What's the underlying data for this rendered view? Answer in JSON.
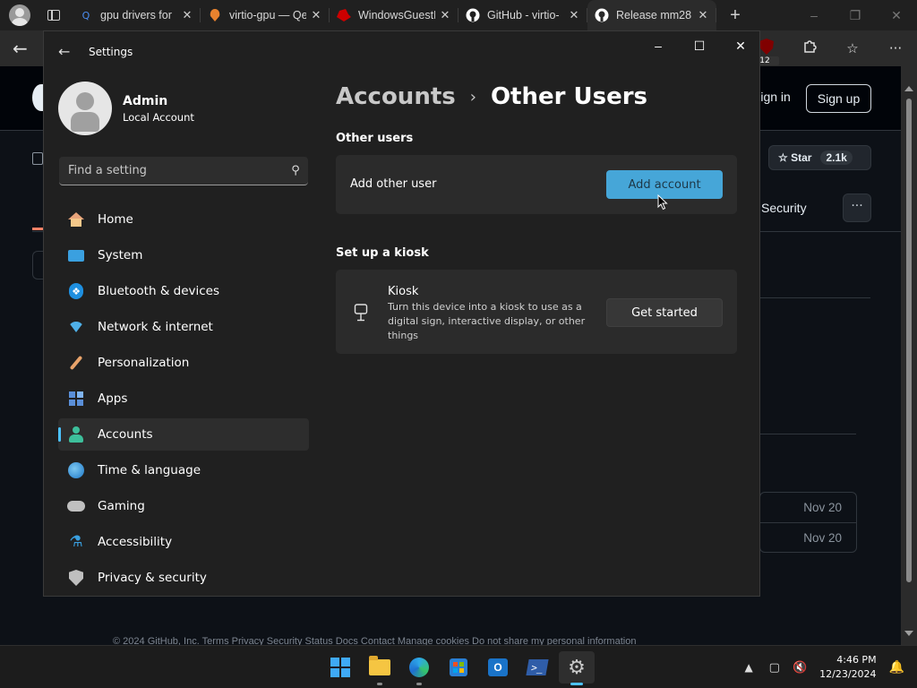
{
  "browser": {
    "tabs": [
      {
        "title": "gpu drivers for",
        "favicon": "search-icon",
        "color": "#4a8df0"
      },
      {
        "title": "virtio-gpu — Qe",
        "favicon": "qemu-logo",
        "color": "#e8822e"
      },
      {
        "title": "WindowsGuestI",
        "favicon": "redhat-logo",
        "color": "#cc0000"
      },
      {
        "title": "GitHub - virtio-",
        "favicon": "github-logo",
        "color": "#ffffff"
      },
      {
        "title": "Release mm28",
        "favicon": "github-logo",
        "color": "#ffffff",
        "active": true
      }
    ],
    "close_glyph": "✕",
    "new_tab_glyph": "+",
    "extension_badge": "12"
  },
  "github": {
    "sign_in": "Sign in",
    "sign_up": "Sign up",
    "star_label": "Star",
    "star_count": "2.1k",
    "security_tab": "Security",
    "more_glyph": "···",
    "dates": [
      "Nov 20",
      "Nov 20"
    ],
    "footer": "© 2024 GitHub, Inc.  Terms  Privacy  Security  Status  Docs  Contact  Manage cookies  Do not share my personal information"
  },
  "settings": {
    "window_title": "Settings",
    "user": {
      "name": "Admin",
      "account_type": "Local Account"
    },
    "search_placeholder": "Find a setting",
    "nav": [
      {
        "label": "Home",
        "icon": "home-icon"
      },
      {
        "label": "System",
        "icon": "system-icon"
      },
      {
        "label": "Bluetooth & devices",
        "icon": "bluetooth-icon"
      },
      {
        "label": "Network & internet",
        "icon": "wifi-icon"
      },
      {
        "label": "Personalization",
        "icon": "brush-icon"
      },
      {
        "label": "Apps",
        "icon": "apps-icon"
      },
      {
        "label": "Accounts",
        "icon": "accounts-icon",
        "selected": true
      },
      {
        "label": "Time & language",
        "icon": "globe-clock-icon"
      },
      {
        "label": "Gaming",
        "icon": "gamepad-icon"
      },
      {
        "label": "Accessibility",
        "icon": "accessibility-icon"
      },
      {
        "label": "Privacy & security",
        "icon": "shield-icon"
      }
    ],
    "breadcrumb": {
      "parent": "Accounts",
      "separator": "›",
      "current": "Other Users"
    },
    "other_users": {
      "heading": "Other users",
      "row_label": "Add other user",
      "button": "Add account"
    },
    "kiosk": {
      "heading": "Set up a kiosk",
      "title": "Kiosk",
      "description": "Turn this device into a kiosk to use as a digital sign, interactive display, or other things",
      "button": "Get started"
    },
    "accent_color": "#4cc2ff"
  },
  "taskbar": {
    "time": "4:46 PM",
    "date": "12/23/2024",
    "ps_label": ">_",
    "outlook_label": "O"
  }
}
